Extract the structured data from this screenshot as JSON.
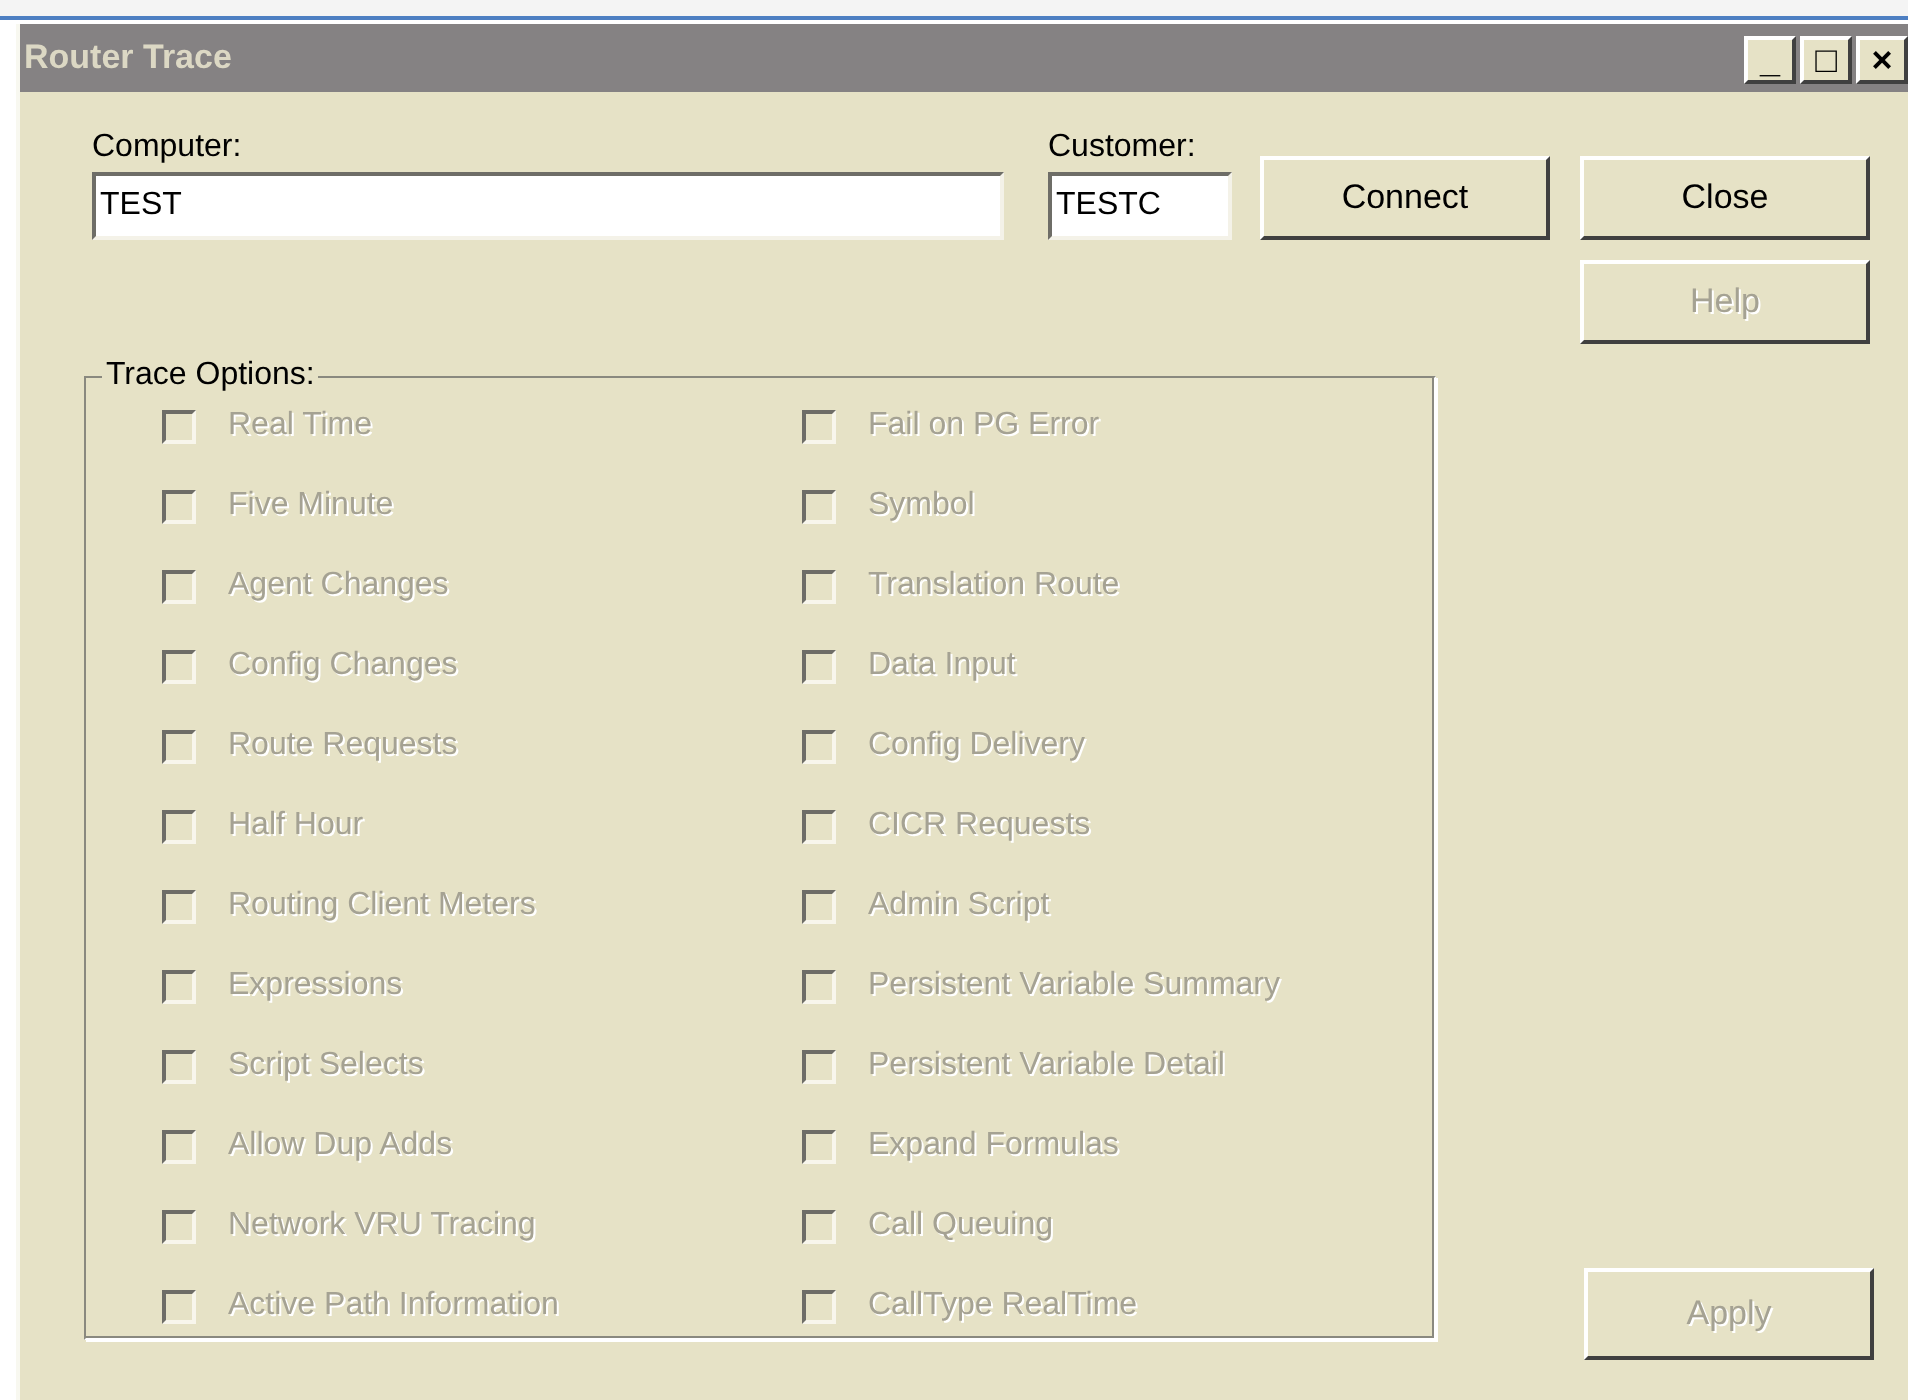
{
  "window": {
    "title": "Router Trace",
    "controls": [
      "_",
      "□",
      "×"
    ]
  },
  "computer": {
    "label": "Computer:",
    "value": "TEST"
  },
  "customer": {
    "label": "Customer:",
    "value": "TESTC"
  },
  "buttons": [
    {
      "label": "Connect",
      "disabled": false
    },
    {
      "label": "Close",
      "disabled": false
    },
    {
      "label": "Help",
      "disabled": true
    }
  ],
  "trace_options": {
    "title": "Trace Options:",
    "columns": [
      [
        {
          "label": "Real Time",
          "checked": false,
          "disabled": true
        },
        {
          "label": "Five Minute",
          "checked": false,
          "disabled": true
        },
        {
          "label": "Agent Changes",
          "checked": false,
          "disabled": true
        },
        {
          "label": "Config Changes",
          "checked": false,
          "disabled": true
        },
        {
          "label": "Route Requests",
          "checked": false,
          "disabled": true
        },
        {
          "label": "Half Hour",
          "checked": false,
          "disabled": true
        },
        {
          "label": "Routing Client Meters",
          "checked": false,
          "disabled": true
        },
        {
          "label": "Expressions",
          "checked": false,
          "disabled": true
        },
        {
          "label": "Script Selects",
          "checked": false,
          "disabled": true
        },
        {
          "label": "Allow Dup Adds",
          "checked": false,
          "disabled": true
        },
        {
          "label": "Network VRU Tracing",
          "checked": false,
          "disabled": true
        },
        {
          "label": "Active Path Information",
          "checked": false,
          "disabled": true
        }
      ],
      [
        {
          "label": "Fail on PG Error",
          "checked": false,
          "disabled": true
        },
        {
          "label": "Symbol",
          "checked": false,
          "disabled": true
        },
        {
          "label": "Translation Route",
          "checked": false,
          "disabled": true
        },
        {
          "label": "Data Input",
          "checked": false,
          "disabled": true
        },
        {
          "label": "Config Delivery",
          "checked": false,
          "disabled": true
        },
        {
          "label": "CICR Requests",
          "checked": false,
          "disabled": true
        },
        {
          "label": "Admin Script",
          "checked": false,
          "disabled": true
        },
        {
          "label": "Persistent Variable Summary",
          "checked": false,
          "disabled": true
        },
        {
          "label": "Persistent Variable Detail",
          "checked": false,
          "disabled": true
        },
        {
          "label": "Expand Formulas",
          "checked": false,
          "disabled": true
        },
        {
          "label": "Call Queuing",
          "checked": false,
          "disabled": true
        },
        {
          "label": "CallType RealTime",
          "checked": false,
          "disabled": true
        }
      ]
    ]
  },
  "apply_button": {
    "label": "Apply",
    "disabled": true
  }
}
